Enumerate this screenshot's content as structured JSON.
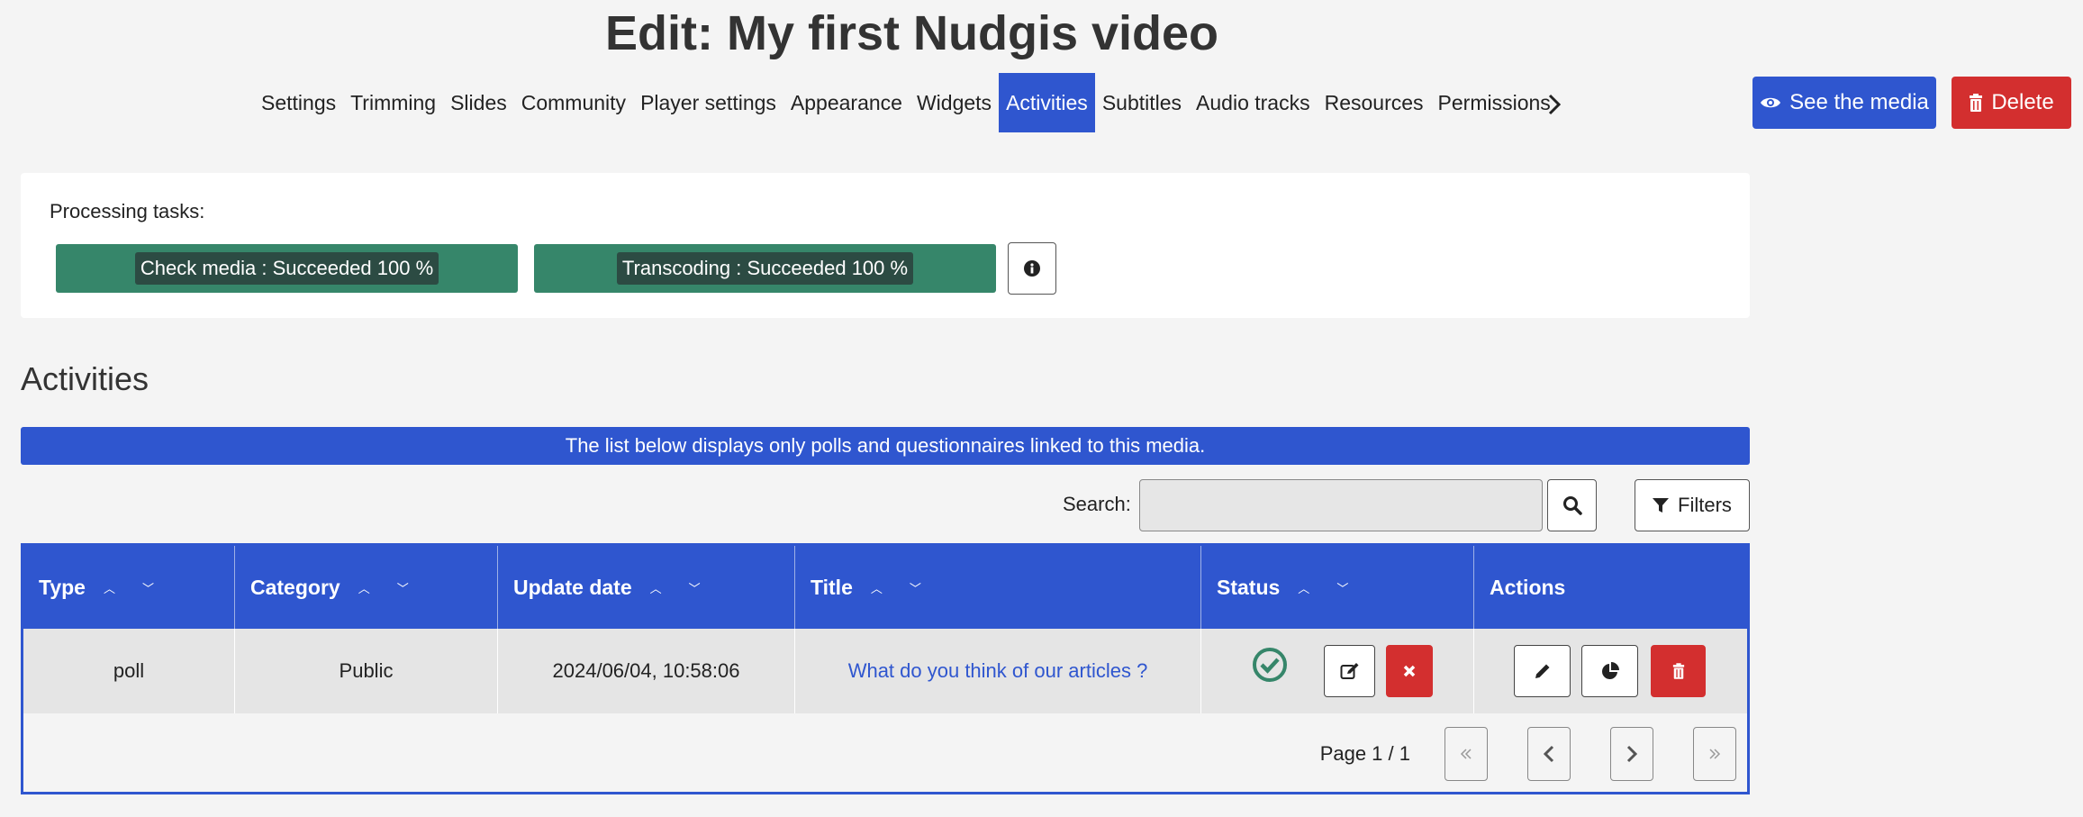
{
  "page": {
    "title": "Edit: My first Nudgis video"
  },
  "nav": {
    "tabs": [
      "Settings",
      "Trimming",
      "Slides",
      "Community",
      "Player settings",
      "Appearance",
      "Widgets",
      "Activities",
      "Subtitles",
      "Audio tracks",
      "Resources",
      "Permissions"
    ],
    "active_tab": "Activities",
    "next_icon": "chevron-right-icon"
  },
  "header_actions": {
    "see_media_label": "See the media",
    "delete_label": "Delete"
  },
  "processing": {
    "label": "Processing tasks:",
    "tasks": [
      {
        "text": "Check media : Succeeded 100 %",
        "progress": 100,
        "status": "Succeeded"
      },
      {
        "text": "Transcoding : Succeeded 100 %",
        "progress": 100,
        "status": "Succeeded"
      }
    ],
    "info_icon": "info-icon"
  },
  "activities": {
    "heading": "Activities",
    "notice": "The list below displays only polls and questionnaires linked to this media.",
    "search": {
      "label": "Search:",
      "value": "",
      "placeholder": ""
    },
    "filters_label": "Filters",
    "table": {
      "columns": [
        "Type",
        "Category",
        "Update date",
        "Title",
        "Status",
        "Actions"
      ],
      "rows": [
        {
          "type": "poll",
          "category": "Public",
          "update_date": "2024/06/04, 10:58:06",
          "title": "What do you think of our articles ?",
          "status": "active"
        }
      ]
    },
    "pagination": {
      "text": "Page 1 / 1"
    }
  },
  "colors": {
    "primary": "#2f56cf",
    "danger": "#d32f2f",
    "success": "#36866a",
    "background": "#f4f4f4"
  }
}
